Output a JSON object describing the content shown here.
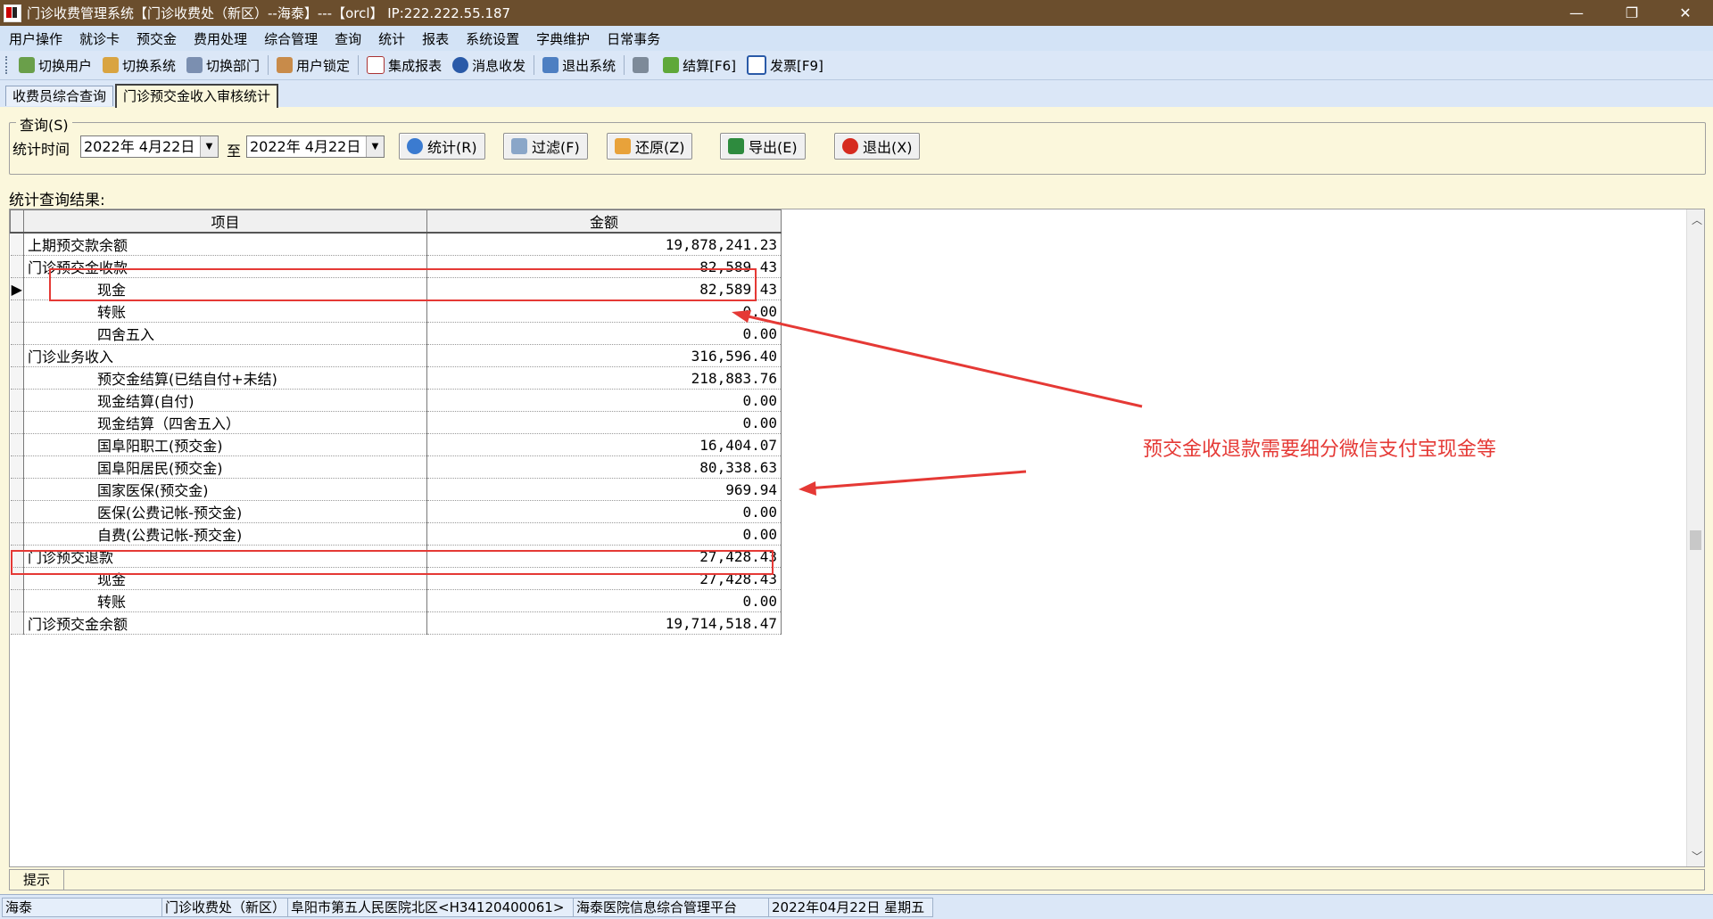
{
  "window": {
    "title": "门诊收费管理系统【门诊收费处（新区）--海泰】---【orcl】 IP:222.222.55.187",
    "controls": {
      "minimize": "—",
      "restore": "❐",
      "close": "✕"
    }
  },
  "menu": [
    "用户操作",
    "就诊卡",
    "预交金",
    "费用处理",
    "综合管理",
    "查询",
    "统计",
    "报表",
    "系统设置",
    "字典维护",
    "日常事务"
  ],
  "toolbar": {
    "switch_user": "切换用户",
    "switch_system": "切换系统",
    "switch_dept": "切换部门",
    "user_lock": "用户锁定",
    "integrated_report": "集成报表",
    "message": "消息收发",
    "exit_system": "退出系统",
    "settle": "结算[F6]",
    "invoice": "发票[F9]"
  },
  "tabs": [
    "收费员综合查询",
    "门诊预交金收入审核统计"
  ],
  "query": {
    "group_label": "查询(S)",
    "time_label": "统计时间",
    "date_from": "2022年 4月22日",
    "to_label": "至",
    "date_to": "2022年 4月22日",
    "buttons": {
      "stat": "统计(R)",
      "filter": "过滤(F)",
      "restore": "还原(Z)",
      "export": "导出(E)",
      "exit": "退出(X)"
    }
  },
  "results": {
    "label": "统计查询结果:",
    "columns": [
      "项目",
      "金额"
    ],
    "rows": [
      {
        "item": "上期预交款余额",
        "amount": "19,878,241.23",
        "level": 0
      },
      {
        "item": "门诊预交金收款",
        "amount": "82,589.43",
        "level": 0
      },
      {
        "item": "现金",
        "amount": "82,589.43",
        "level": 1,
        "current": true
      },
      {
        "item": "转账",
        "amount": "0.00",
        "level": 1
      },
      {
        "item": "四舍五入",
        "amount": "0.00",
        "level": 1
      },
      {
        "item": "门诊业务收入",
        "amount": "316,596.40",
        "level": 0
      },
      {
        "item": "预交金结算(已结自付+未结)",
        "amount": "218,883.76",
        "level": 1
      },
      {
        "item": "现金结算(自付)",
        "amount": "0.00",
        "level": 1
      },
      {
        "item": "现金结算（四舍五入）",
        "amount": "0.00",
        "level": 1
      },
      {
        "item": "国阜阳职工(预交金)",
        "amount": "16,404.07",
        "level": 1
      },
      {
        "item": "国阜阳居民(预交金)",
        "amount": "80,338.63",
        "level": 1
      },
      {
        "item": "国家医保(预交金)",
        "amount": "969.94",
        "level": 1
      },
      {
        "item": "医保(公费记帐-预交金)",
        "amount": "0.00",
        "level": 1
      },
      {
        "item": "自费(公费记帐-预交金)",
        "amount": "0.00",
        "level": 1
      },
      {
        "item": "门诊预交退款",
        "amount": "27,428.43",
        "level": 0
      },
      {
        "item": "现金",
        "amount": "27,428.43",
        "level": 1
      },
      {
        "item": "转账",
        "amount": "0.00",
        "level": 1
      },
      {
        "item": "门诊预交金余额",
        "amount": "19,714,518.47",
        "level": 0
      }
    ]
  },
  "annotation": {
    "text": "预交金收退款需要细分微信支付宝现金等",
    "color": "#e53935"
  },
  "tip": {
    "label": "提示"
  },
  "status": {
    "user": "海泰",
    "dept": "门诊收费处（新区）",
    "hospital": "阜阳市第五人民医院北区<H34120400061>",
    "platform": "海泰医院信息综合管理平台",
    "date": "2022年04月22日 星期五"
  },
  "colors": {
    "titlebar": "#6b4e2d",
    "menubar": "#d3e3f6",
    "background": "#fbf7dc",
    "highlight": "#e53935"
  }
}
